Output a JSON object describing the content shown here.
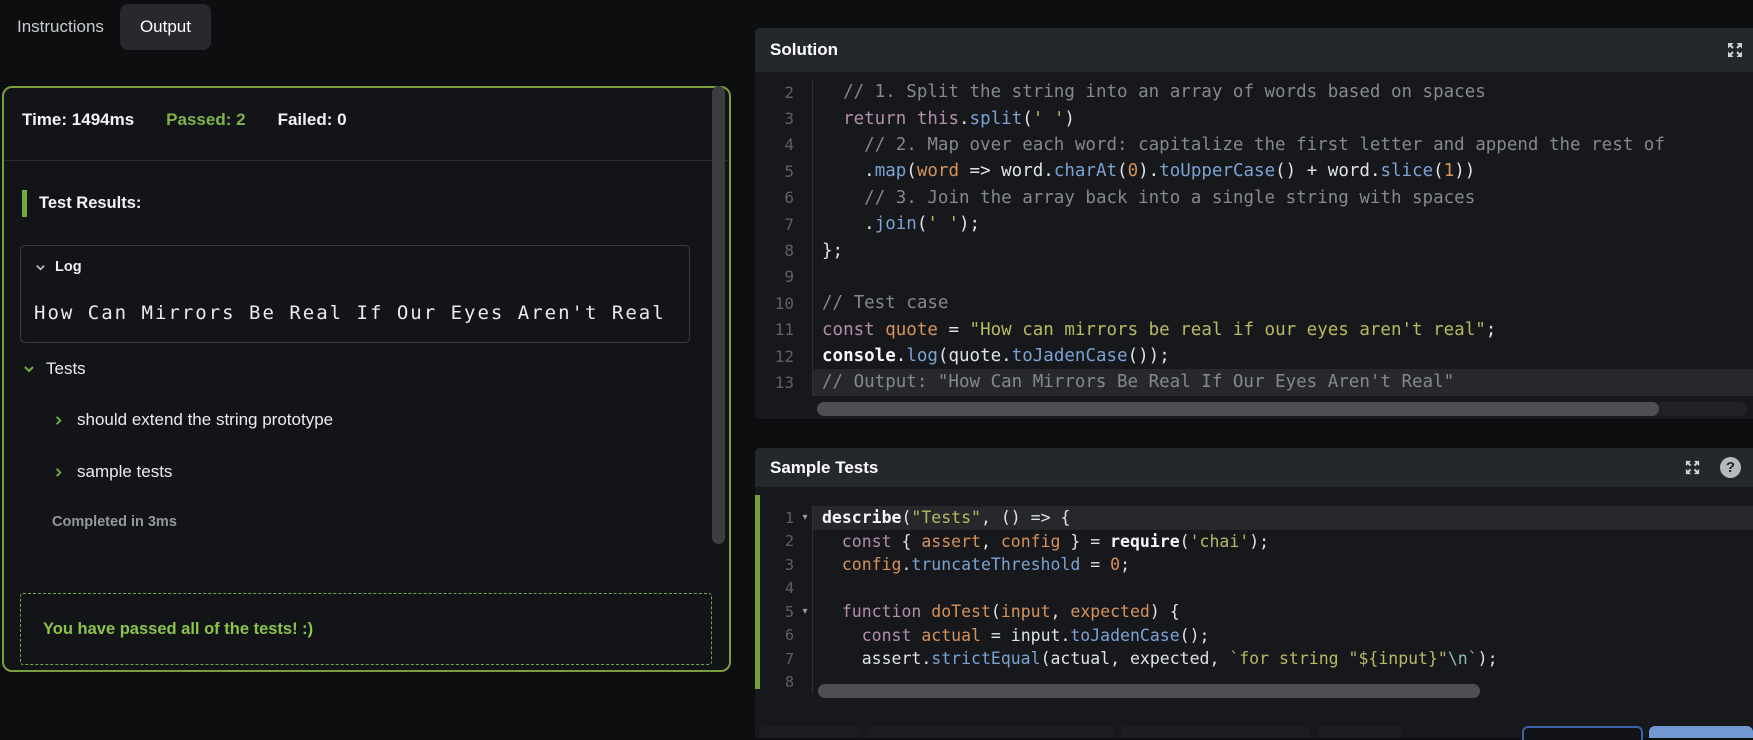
{
  "tabs": {
    "instructions": "Instructions",
    "output": "Output"
  },
  "output_panel": {
    "time_label": "Time:",
    "time_value": "1494ms",
    "passed_label": "Passed:",
    "passed_value": "2",
    "failed_label": "Failed:",
    "failed_value": "0",
    "test_results_heading": "Test Results:",
    "log": {
      "title": "Log",
      "content": "How Can Mirrors Be Real If Our Eyes Aren't Real"
    },
    "tests_heading": "Tests",
    "test_items": [
      "should extend the string prototype",
      "sample tests"
    ],
    "completed": "Completed in 3ms",
    "passed_message": "You have passed all of the tests! :)"
  },
  "solution_panel": {
    "title": "Solution",
    "lines": [
      {
        "no": "2",
        "tokens": [
          [
            "t",
            "  "
          ],
          [
            "c",
            "// 1. Split the string into an array of words based on spaces"
          ]
        ]
      },
      {
        "no": "3",
        "tokens": [
          [
            "t",
            "  "
          ],
          [
            "k",
            "return"
          ],
          [
            "t",
            " "
          ],
          [
            "k",
            "this"
          ],
          [
            "t",
            "."
          ],
          [
            "m",
            "split"
          ],
          [
            "t",
            "("
          ],
          [
            "s",
            "' '"
          ],
          [
            "t",
            ")"
          ]
        ]
      },
      {
        "no": "4",
        "tokens": [
          [
            "t",
            "    "
          ],
          [
            "c",
            "// 2. Map over each word: capitalize the first letter and append the rest of"
          ]
        ]
      },
      {
        "no": "5",
        "tokens": [
          [
            "t",
            "    ."
          ],
          [
            "m",
            "map"
          ],
          [
            "t",
            "("
          ],
          [
            "v",
            "word"
          ],
          [
            "t",
            " => word."
          ],
          [
            "m",
            "charAt"
          ],
          [
            "t",
            "("
          ],
          [
            "n",
            "0"
          ],
          [
            "t",
            ")."
          ],
          [
            "m",
            "toUpperCase"
          ],
          [
            "t",
            "() + word."
          ],
          [
            "m",
            "slice"
          ],
          [
            "t",
            "("
          ],
          [
            "n",
            "1"
          ],
          [
            "t",
            "))"
          ]
        ]
      },
      {
        "no": "6",
        "tokens": [
          [
            "t",
            "    "
          ],
          [
            "c",
            "// 3. Join the array back into a single string with spaces"
          ]
        ]
      },
      {
        "no": "7",
        "tokens": [
          [
            "t",
            "    ."
          ],
          [
            "m",
            "join"
          ],
          [
            "t",
            "("
          ],
          [
            "s",
            "' '"
          ],
          [
            "t",
            ");"
          ]
        ]
      },
      {
        "no": "8",
        "tokens": [
          [
            "t",
            "};"
          ]
        ]
      },
      {
        "no": "9",
        "tokens": []
      },
      {
        "no": "10",
        "tokens": [
          [
            "c",
            "// Test case"
          ]
        ]
      },
      {
        "no": "11",
        "tokens": [
          [
            "k",
            "const"
          ],
          [
            "t",
            " "
          ],
          [
            "v",
            "quote"
          ],
          [
            "t",
            " = "
          ],
          [
            "s",
            "\"How can mirrors be real if our eyes aren't real\""
          ],
          [
            "t",
            ";"
          ]
        ]
      },
      {
        "no": "12",
        "tokens": [
          [
            "w",
            "console"
          ],
          [
            "t",
            "."
          ],
          [
            "m",
            "log"
          ],
          [
            "t",
            "(quote."
          ],
          [
            "m",
            "toJadenCase"
          ],
          [
            "t",
            "());"
          ]
        ]
      },
      {
        "no": "13",
        "hl": true,
        "tokens": [
          [
            "c",
            "// Output: \"How Can Mirrors Be Real If Our Eyes Aren't Real\""
          ]
        ]
      }
    ]
  },
  "sample_panel": {
    "title": "Sample Tests",
    "lines": [
      {
        "no": "1",
        "hl": true,
        "fold": true,
        "tokens": [
          [
            "w",
            "describe"
          ],
          [
            "t",
            "("
          ],
          [
            "s",
            "\"Tests\""
          ],
          [
            "t",
            ", () => {"
          ]
        ]
      },
      {
        "no": "2",
        "tokens": [
          [
            "t",
            "  "
          ],
          [
            "k",
            "const"
          ],
          [
            "t",
            " { "
          ],
          [
            "v",
            "assert"
          ],
          [
            "t",
            ", "
          ],
          [
            "v",
            "config"
          ],
          [
            "t",
            " } = "
          ],
          [
            "w",
            "require"
          ],
          [
            "t",
            "("
          ],
          [
            "s",
            "'chai'"
          ],
          [
            "t",
            ");"
          ]
        ]
      },
      {
        "no": "3",
        "tokens": [
          [
            "t",
            "  "
          ],
          [
            "v",
            "config"
          ],
          [
            "t",
            "."
          ],
          [
            "m",
            "truncateThreshold"
          ],
          [
            "t",
            " = "
          ],
          [
            "n",
            "0"
          ],
          [
            "t",
            ";"
          ]
        ]
      },
      {
        "no": "4",
        "tokens": []
      },
      {
        "no": "5",
        "fold": true,
        "tokens": [
          [
            "t",
            "  "
          ],
          [
            "k",
            "function"
          ],
          [
            "t",
            " "
          ],
          [
            "v",
            "doTest"
          ],
          [
            "t",
            "("
          ],
          [
            "v",
            "input"
          ],
          [
            "t",
            ", "
          ],
          [
            "v",
            "expected"
          ],
          [
            "t",
            ") {"
          ]
        ]
      },
      {
        "no": "6",
        "tokens": [
          [
            "t",
            "    "
          ],
          [
            "k",
            "const"
          ],
          [
            "t",
            " "
          ],
          [
            "v",
            "actual"
          ],
          [
            "t",
            " = input."
          ],
          [
            "m",
            "toJadenCase"
          ],
          [
            "t",
            "();"
          ]
        ]
      },
      {
        "no": "7",
        "tokens": [
          [
            "t",
            "    assert."
          ],
          [
            "m",
            "strictEqual"
          ],
          [
            "t",
            "(actual, expected, "
          ],
          [
            "s",
            "`for string \"${input}\""
          ],
          [
            "e",
            "\\n"
          ],
          [
            "s",
            "`"
          ],
          [
            "t",
            ");"
          ]
        ]
      },
      {
        "no": "8",
        "tokens": []
      }
    ]
  },
  "colors": {
    "panel_border_green": "#7a9e3e",
    "passed_green": "#7fb347",
    "message_green": "#8bc34a",
    "accent_blue_button": "#7498d4",
    "editor_bg": "#17181c",
    "header_bg": "#24272b"
  }
}
